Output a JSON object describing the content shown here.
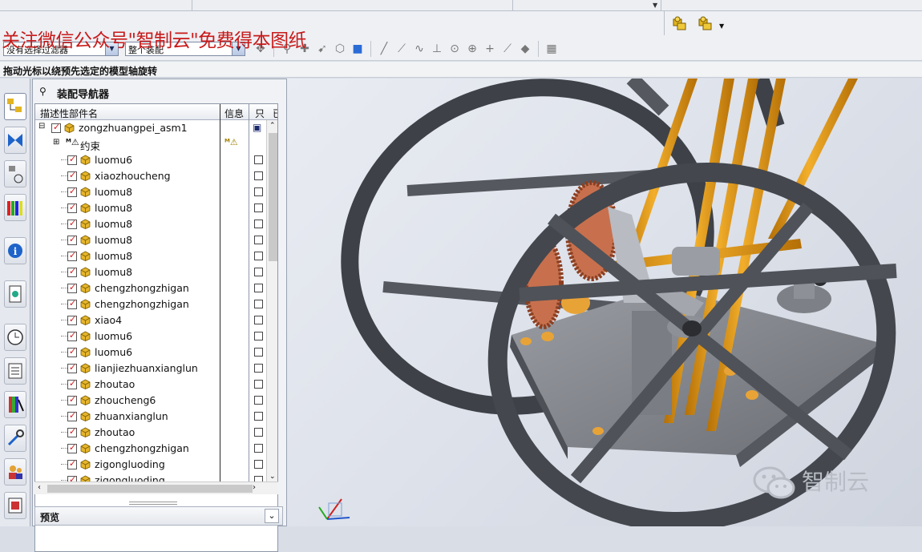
{
  "watermark": "关注微信公众号\"智制云\"免费得本图纸",
  "filter": {
    "selection_filter": "没有选择过滤器",
    "scope": "整个装配"
  },
  "statusline": "拖动光标以绕预先选定的模型轴旋转",
  "navigator": {
    "title": "装配导航器",
    "columns": {
      "name": "描述性部件名",
      "info": "信息",
      "readonly": "只",
      "extra": "已"
    },
    "root": "zongzhuangpei_asm1",
    "constraints": "约束",
    "parts": [
      "luomu6",
      "xiaozhoucheng",
      "luomu8",
      "luomu8",
      "luomu8",
      "luomu8",
      "luomu8",
      "luomu8",
      "chengzhongzhigan",
      "chengzhongzhigan",
      "xiao4",
      "luomu6",
      "luomu6",
      "lianjiezhuanxianglun",
      "zhoutao",
      "zhoucheng6",
      "zhuanxianglun",
      "zhoutao",
      "chengzhongzhigan",
      "zigongluoding",
      "zigongluoding"
    ],
    "preview": "预览"
  },
  "brand": "智制云",
  "colors": {
    "accent_red": "#c81a1a",
    "frame_gray": "#4a4d53",
    "rod_orange": "#e69a1c",
    "gear_copper": "#c8704d"
  }
}
